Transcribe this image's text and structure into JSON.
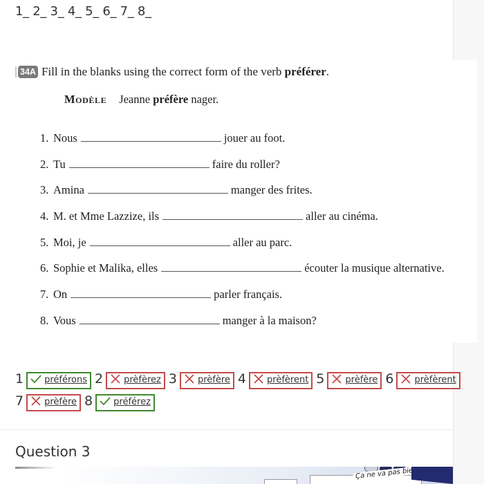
{
  "blanks_prompt": "1_ 2_ 3_ 4_ 5_ 6_ 7_ 8_",
  "worksheet": {
    "badge": "34A",
    "instruction_prefix": "Fill in the blanks using the correct form of the verb ",
    "instruction_verb": "préférer",
    "instruction_suffix": ".",
    "model_label": "Modèle",
    "model_before": "Jeanne ",
    "model_verb": "préfère",
    "model_after": " nager.",
    "items": [
      {
        "num": "1.",
        "before": "Nous",
        "after": "jouer au foot."
      },
      {
        "num": "2.",
        "before": "Tu",
        "after": "faire du roller?"
      },
      {
        "num": "3.",
        "before": "Amina",
        "after": "manger des frites."
      },
      {
        "num": "4.",
        "before": "M. et Mme Lazzize, ils",
        "after": "aller au cinéma."
      },
      {
        "num": "5.",
        "before": "Moi, je",
        "after": "aller au parc."
      },
      {
        "num": "6.",
        "before": "Sophie et Malika, elles",
        "after": "écouter la musique alternative."
      },
      {
        "num": "7.",
        "before": "On",
        "after": "parler français."
      },
      {
        "num": "8.",
        "before": "Vous",
        "after": "manger à la maison?"
      }
    ]
  },
  "answers": [
    {
      "num": "1",
      "value": "préférons",
      "status": "correct"
    },
    {
      "num": "2",
      "value": "prèfèrez",
      "status": "wrong"
    },
    {
      "num": "3",
      "value": "prèfère",
      "status": "wrong"
    },
    {
      "num": "4",
      "value": "prèfèrent",
      "status": "wrong"
    },
    {
      "num": "5",
      "value": "prèfère",
      "status": "wrong"
    },
    {
      "num": "6",
      "value": "prèfèrent",
      "status": "wrong"
    },
    {
      "num": "7",
      "value": "prèfère",
      "status": "wrong"
    },
    {
      "num": "8",
      "value": "préférez",
      "status": "correct"
    }
  ],
  "colors": {
    "correct": "#3e8a2e",
    "wrong": "#c44a4a"
  },
  "next_question": {
    "title": "Question 3",
    "image_caption": "Ça ne va pas bien!"
  }
}
